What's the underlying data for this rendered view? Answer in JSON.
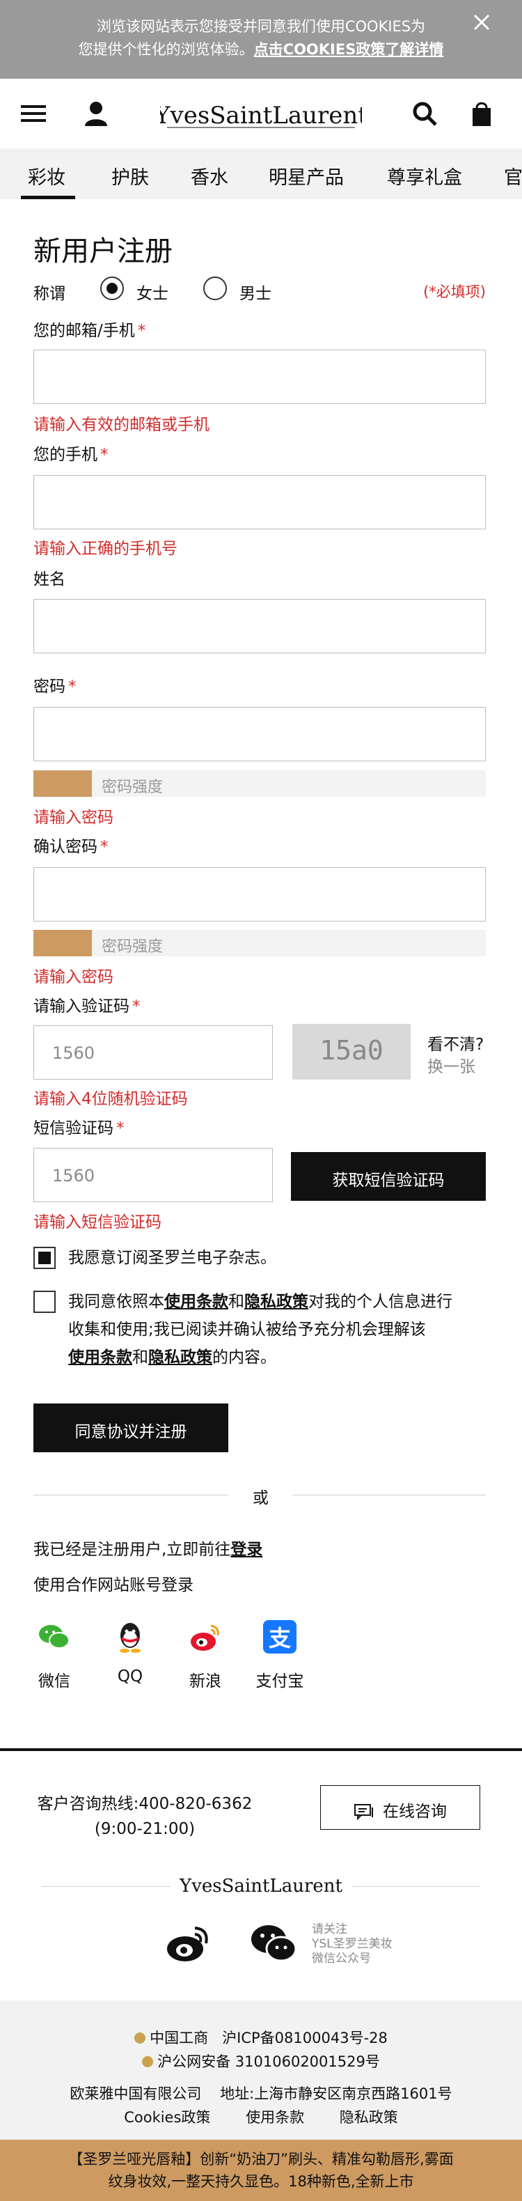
{
  "cookie": {
    "line1": "浏览该网站表示您接受并同意我们使用COOKIES为",
    "line2_prefix": "您提供个性化的浏览体验。",
    "line2_link": "点击COOKIES政策了解详情"
  },
  "header": {
    "brand": "YvesSaintLaurent"
  },
  "categories": [
    "彩妆",
    "护肤",
    "香水",
    "明星产品",
    "尊享礼盒",
    "官"
  ],
  "form": {
    "title": "新用户注册",
    "salutation_label": "称谓",
    "female": "女士",
    "male": "男士",
    "required_note": "(*必填项)",
    "email_label": "您的邮箱/手机",
    "email_error": "请输入有效的邮箱或手机",
    "phone_label": "您的手机",
    "phone_error": "请输入正确的手机号",
    "name_label": "姓名",
    "password_label": "密码",
    "strength_label": "密码强度",
    "password_error": "请输入密码",
    "confirm_label": "确认密码",
    "confirm_strength_label": "密码强度",
    "confirm_error": "请输入密码",
    "captcha_label": "请输入验证码",
    "captcha_placeholder": "1560",
    "captcha_image_text": "15a0",
    "captcha_unclear": "看不清?",
    "captcha_refresh": "换一张",
    "captcha_error": "请输入4位随机验证码",
    "sms_label": "短信验证码",
    "sms_placeholder": "1560",
    "sms_button": "获取短信验证码",
    "sms_error": "请输入短信验证码",
    "newsletter": "我愿意订阅圣罗兰电子杂志。",
    "agree_l1_a": "我同意依照本",
    "agree_terms": "使用条款",
    "agree_and": "和",
    "agree_privacy": "隐私政策",
    "agree_l1_b": "对我的个人信息进行",
    "agree_l2": "收集和使用;我已阅读并确认被给予充分机会理解该",
    "agree_l3_terms": "使用条款",
    "agree_l3_and": "和",
    "agree_l3_privacy": "隐私政策",
    "agree_l3_end": "的内容。",
    "submit": "同意协议并注册",
    "or": "或",
    "already_prefix": "我已经是注册用户,立即前往",
    "already_login": "登录",
    "partner_label": "使用合作网站账号登录"
  },
  "social": [
    {
      "name": "微信",
      "icon": "wechat-icon",
      "color": "#3cb034"
    },
    {
      "name": "QQ",
      "icon": "qq-icon",
      "color": "#1d1d1d"
    },
    {
      "name": "新浪",
      "icon": "weibo-icon",
      "color": "#e6162d"
    },
    {
      "name": "支付宝",
      "icon": "alipay-icon",
      "color": "#1677ff"
    }
  ],
  "footer": {
    "hotline_line1": "客户咨询热线:400-820-6362",
    "hotline_line2": "(9:00-21:00)",
    "online": "在线咨询",
    "wechat_note_1": "请关注",
    "wechat_note_2": "YSL圣罗兰美妆",
    "wechat_note_3": "微信公众号",
    "icp1_a": "中国工商",
    "icp1_b": "沪ICP备08100043号-28",
    "icp2": "沪公网安备 31010602001529号",
    "company": "欧莱雅中国有限公司",
    "address": "地址:上海市静安区南京西路1601号",
    "links": [
      "Cookies政策",
      "使用条款",
      "隐私政策"
    ],
    "promo_l1": "【圣罗兰哑光唇釉】创新“奶油刀”刷头、精准勾勒唇形,雾面",
    "promo_l2": "纹身妆效,一整天持久显色。18种新色,全新上市"
  }
}
